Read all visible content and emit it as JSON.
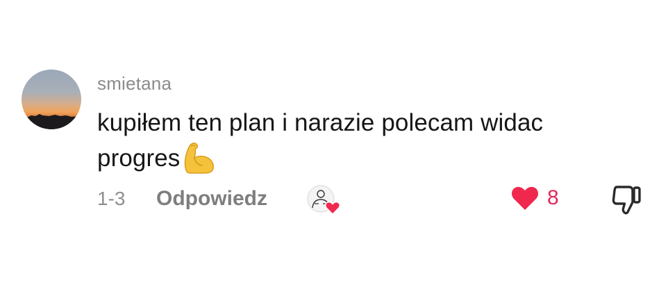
{
  "comment": {
    "username": "smietana",
    "text": "kupiłem ten plan i narazie polecam widac progres",
    "emoji": "flexed-biceps",
    "timestamp": "1-3",
    "reply_label": "Odpowiedz",
    "like_count": "8",
    "liked": true
  },
  "icons": {
    "avatar": "sunset-photo-avatar",
    "creator_liked": "creator-avatar-with-heart-icon",
    "like": "heart-icon",
    "dislike": "thumbs-down-icon"
  },
  "colors": {
    "username": "#8b8b8b",
    "text": "#161616",
    "meta": "#8f8f8f",
    "like": "#f0284e",
    "like_count": "#e22a58"
  }
}
